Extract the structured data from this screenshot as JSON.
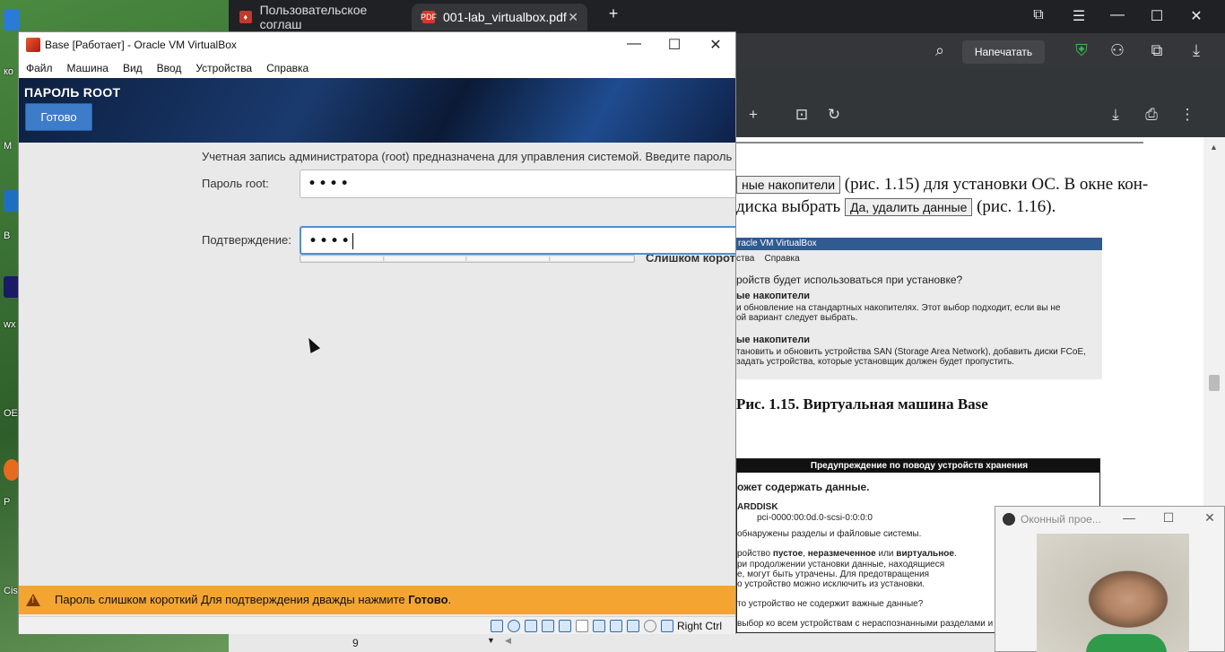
{
  "desktop": {
    "icon_labels": [
      "ко",
      "М",
      "В",
      "wx",
      "OE",
      "P",
      "Cis"
    ]
  },
  "browser": {
    "tabs": [
      {
        "label": "Пользовательское соглаш",
        "active": false
      },
      {
        "label": "001-lab_virtualbox.pdf",
        "active": true
      }
    ],
    "print_label": "Напечатать",
    "pdf": {
      "line1_btn": "ные накопители",
      "line1_text": "(рис. 1.15) для установки ОС. В окне кон-",
      "line2_text_a": "диска выбрать",
      "line2_btn": "Да, удалить данные",
      "line2_text_b": "(рис. 1.16).",
      "fig1": {
        "title": "racle VM VirtualBox",
        "menu": [
          "ства",
          "Справка"
        ],
        "question": "ройств будет использоваться при установке?",
        "opt1_title": "ые накопители",
        "opt1_l1": "и обновление на стандартных накопителях. Этот выбор подходит, если вы не",
        "opt1_l2": "ой вариант следует выбрать.",
        "opt2_title": "ые накопители",
        "opt2_l1": "тановить и обновить устройства SAN (Storage Area Network), добавить диски FCoE,",
        "opt2_l2": "задать устройства, которые установщик должен будет пропустить."
      },
      "caption1": "Рис. 1.15. Виртуальная машина Base",
      "fig2": {
        "title": "Предупреждение по поводу устройств хранения",
        "heading": "ожет содержать данные.",
        "disk": "ARDDISK",
        "disk_path": "pci-0000:00:0d.0-scsi-0:0:0:0",
        "l1": "обнаружены разделы и файловые системы.",
        "l2_a": "ройство ",
        "l2_b1": "пустое",
        "l2_c": ", ",
        "l2_b2": "неразмеченное",
        "l2_d": " или ",
        "l2_b3": "виртуальное",
        "l2_e": ".",
        "l3": "ри продолжении установки данные, находящиеся",
        "l4": "е, могут быть утрачены. Для предотвращения",
        "l5": "о устройство можно исключить из установки.",
        "l6": "то устройство не содержит важные данные?",
        "l7": "выбор ко всем устройствам с нераспознанными разделами и"
      },
      "page_number": "9"
    }
  },
  "vbox": {
    "title": "Base [Работает] - Oracle VM VirtualBox",
    "menu": [
      "Файл",
      "Машина",
      "Вид",
      "Ввод",
      "Устройства",
      "Справка"
    ],
    "guest": {
      "screen_title": "ПАРОЛЬ ROOT",
      "done_label": "Готово",
      "description": "Учетная запись администратора (root) предназначена для управления системой. Введите пароль г",
      "password_label": "Пароль root:",
      "password_value": "••••",
      "strength_text": "Слишком коротк",
      "confirm_label": "Подтверждение:",
      "confirm_value": "••••",
      "warning_text": "Пароль слишком короткий Для подтверждения дважды нажмите ",
      "warning_bold": "Готово",
      "warning_end": "."
    },
    "status": {
      "host_key": "Right Ctrl"
    }
  },
  "camera": {
    "title": "Оконный прое..."
  }
}
